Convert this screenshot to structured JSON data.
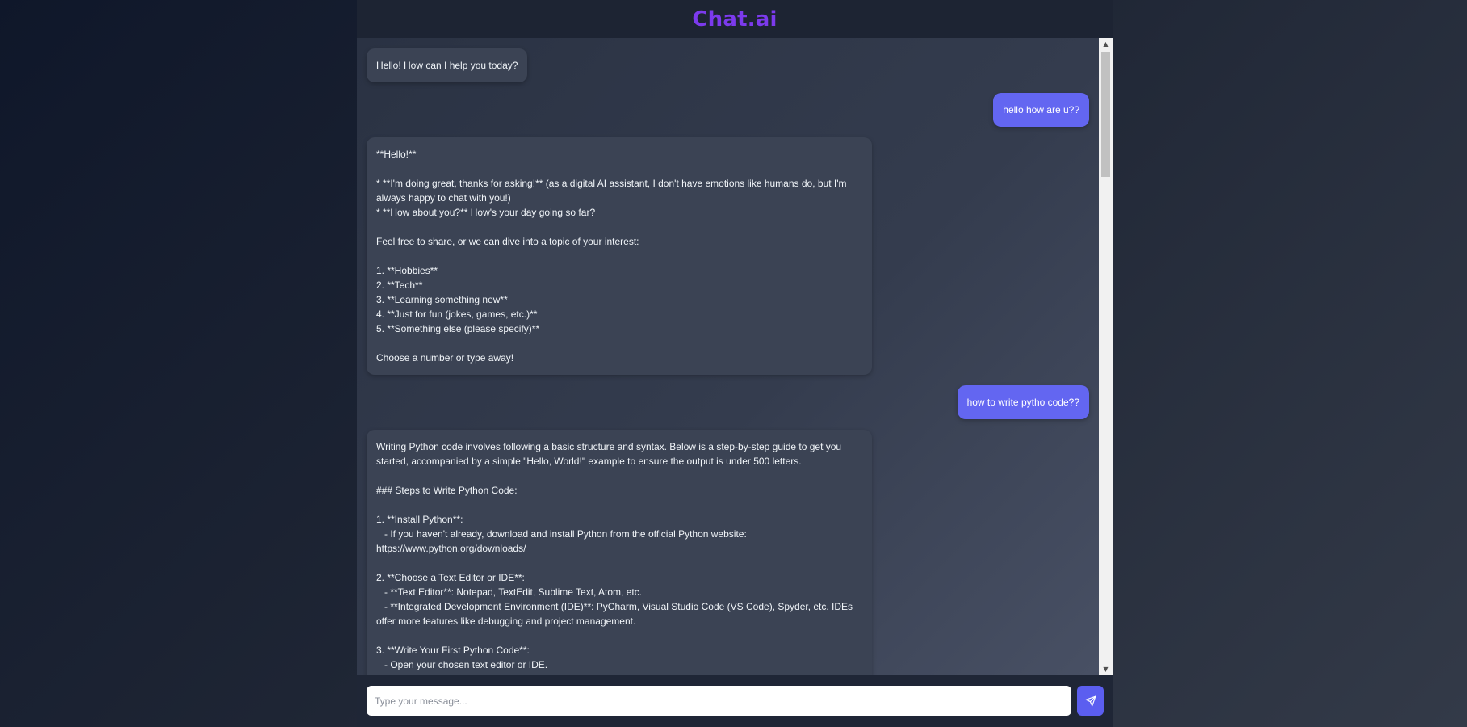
{
  "app": {
    "title": "Chat.ai"
  },
  "messages": [
    {
      "role": "bot",
      "text": "Hello! How can I help you today?"
    },
    {
      "role": "user",
      "text": "hello how are u??"
    },
    {
      "role": "bot",
      "text": "**Hello!**\n\n* **I'm doing great, thanks for asking!** (as a digital AI assistant, I don't have emotions like humans do, but I'm always happy to chat with you!)\n* **How about you?** How's your day going so far?\n\nFeel free to share, or we can dive into a topic of your interest:\n\n1. **Hobbies**\n2. **Tech**\n3. **Learning something new**\n4. **Just for fun (jokes, games, etc.)**\n5. **Something else (please specify)**\n\nChoose a number or type away!"
    },
    {
      "role": "user",
      "text": "how to write pytho code??"
    },
    {
      "role": "bot",
      "text": "Writing Python code involves following a basic structure and syntax. Below is a step-by-step guide to get you started, accompanied by a simple \"Hello, World!\" example to ensure the output is under 500 letters.\n\n### Steps to Write Python Code:\n\n1. **Install Python**:\n   - If you haven't already, download and install Python from the official Python website: https://www.python.org/downloads/\n\n2. **Choose a Text Editor or IDE**:\n   - **Text Editor**: Notepad, TextEdit, Sublime Text, Atom, etc.\n   - **Integrated Development Environment (IDE)**: PyCharm, Visual Studio Code (VS Code), Spyder, etc. IDEs offer more features like debugging and project management.\n\n3. **Write Your First Python Code**:\n   - Open your chosen text editor or IDE.\n   - Copy and paste the following \"Hello, World!\" code into your editor."
    }
  ],
  "input": {
    "placeholder": "Type your message...",
    "value": ""
  },
  "send_button": {
    "icon": "send-icon"
  },
  "colors": {
    "brand": "#7c3aed",
    "user_bubble": "#6366f1",
    "bot_bubble": "#3b4354",
    "send_button": "#5b5ef0"
  }
}
